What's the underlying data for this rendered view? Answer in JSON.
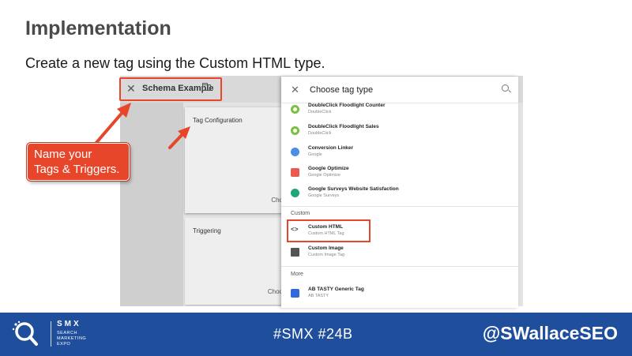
{
  "slide": {
    "title": "Implementation",
    "subtitle": "Create a new tag using the Custom HTML type."
  },
  "gtm": {
    "tag_name": "Schema Example",
    "config_card": {
      "label": "Tag Configuration",
      "choose": "Cho"
    },
    "trigger_card": {
      "label": "Triggering",
      "choose": "Choo"
    }
  },
  "panel": {
    "title": "Choose tag type",
    "items": [
      {
        "name": "DoubleClick Floodlight Counter",
        "sub": "DoubleClick",
        "icon": "doubleclick-icon"
      },
      {
        "name": "DoubleClick Floodlight Sales",
        "sub": "DoubleClick",
        "icon": "doubleclick-icon"
      },
      {
        "name": "Conversion Linker",
        "sub": "Google",
        "icon": "conversion-linker-icon"
      },
      {
        "name": "Google Optimize",
        "sub": "Google Optimize",
        "icon": "google-optimize-icon"
      },
      {
        "name": "Google Surveys Website Satisfaction",
        "sub": "Google Surveys",
        "icon": "google-surveys-icon"
      }
    ],
    "custom_section": "Custom",
    "custom_items": [
      {
        "name": "Custom HTML",
        "sub": "Custom HTML Tag",
        "icon": "code-icon"
      },
      {
        "name": "Custom Image",
        "sub": "Custom Image Tag",
        "icon": "image-icon"
      }
    ],
    "more_section": "More",
    "more_items": [
      {
        "name": "AB TASTY Generic Tag",
        "sub": "AB TASTY",
        "icon": "ab-tasty-icon"
      }
    ]
  },
  "callout": {
    "line1": "Name your",
    "line2": "Tags & Triggers."
  },
  "footer": {
    "logo_text": "SMX",
    "logo_sub": "SEARCH MARKETING EXPO",
    "hashtag": "#SMX #24B",
    "handle": "@SWallaceSEO"
  },
  "colors": {
    "accent": "#e8462a",
    "footer_bg": "#1f4f9c"
  }
}
